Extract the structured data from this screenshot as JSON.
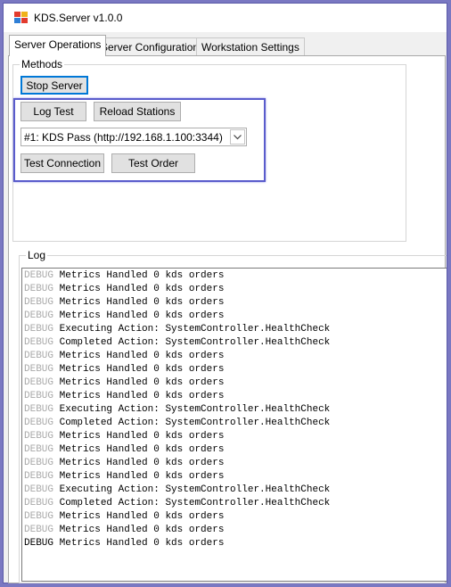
{
  "window": {
    "title": "KDS.Server v1.0.0",
    "colors": {
      "accent": "#0078d7",
      "highlight": "#5a5ccc",
      "log_level_faded": "#a9a9a9"
    }
  },
  "tabs": [
    {
      "label": "Server Operations",
      "active": true
    },
    {
      "label": "Server Configurations",
      "active": false
    },
    {
      "label": "Workstation Settings",
      "active": false
    }
  ],
  "methods": {
    "group_label": "Methods",
    "stop_server": "Stop Server",
    "log_test": "Log Test",
    "reload_stations": "Reload Stations",
    "station_select": {
      "selected": "#1: KDS Pass (http://192.168.1.100:3344)"
    },
    "test_connection": "Test Connection",
    "test_order": "Test Order"
  },
  "log": {
    "group_label": "Log",
    "entries": [
      {
        "level": "DEBUG",
        "message": "Metrics Handled 0 kds orders"
      },
      {
        "level": "DEBUG",
        "message": "Metrics Handled 0 kds orders"
      },
      {
        "level": "DEBUG",
        "message": "Metrics Handled 0 kds orders"
      },
      {
        "level": "DEBUG",
        "message": "Metrics Handled 0 kds orders"
      },
      {
        "level": "DEBUG",
        "message": "Executing Action: SystemController.HealthCheck"
      },
      {
        "level": "DEBUG",
        "message": "Completed Action: SystemController.HealthCheck"
      },
      {
        "level": "DEBUG",
        "message": "Metrics Handled 0 kds orders"
      },
      {
        "level": "DEBUG",
        "message": "Metrics Handled 0 kds orders"
      },
      {
        "level": "DEBUG",
        "message": "Metrics Handled 0 kds orders"
      },
      {
        "level": "DEBUG",
        "message": "Metrics Handled 0 kds orders"
      },
      {
        "level": "DEBUG",
        "message": "Executing Action: SystemController.HealthCheck"
      },
      {
        "level": "DEBUG",
        "message": "Completed Action: SystemController.HealthCheck"
      },
      {
        "level": "DEBUG",
        "message": "Metrics Handled 0 kds orders"
      },
      {
        "level": "DEBUG",
        "message": "Metrics Handled 0 kds orders"
      },
      {
        "level": "DEBUG",
        "message": "Metrics Handled 0 kds orders"
      },
      {
        "level": "DEBUG",
        "message": "Metrics Handled 0 kds orders"
      },
      {
        "level": "DEBUG",
        "message": "Executing Action: SystemController.HealthCheck"
      },
      {
        "level": "DEBUG",
        "message": "Completed Action: SystemController.HealthCheck"
      },
      {
        "level": "DEBUG",
        "message": "Metrics Handled 0 kds orders"
      },
      {
        "level": "DEBUG",
        "message": "Metrics Handled 0 kds orders"
      },
      {
        "level": "DEBUG",
        "message": "Metrics Handled 0 kds orders",
        "current": true
      }
    ]
  }
}
